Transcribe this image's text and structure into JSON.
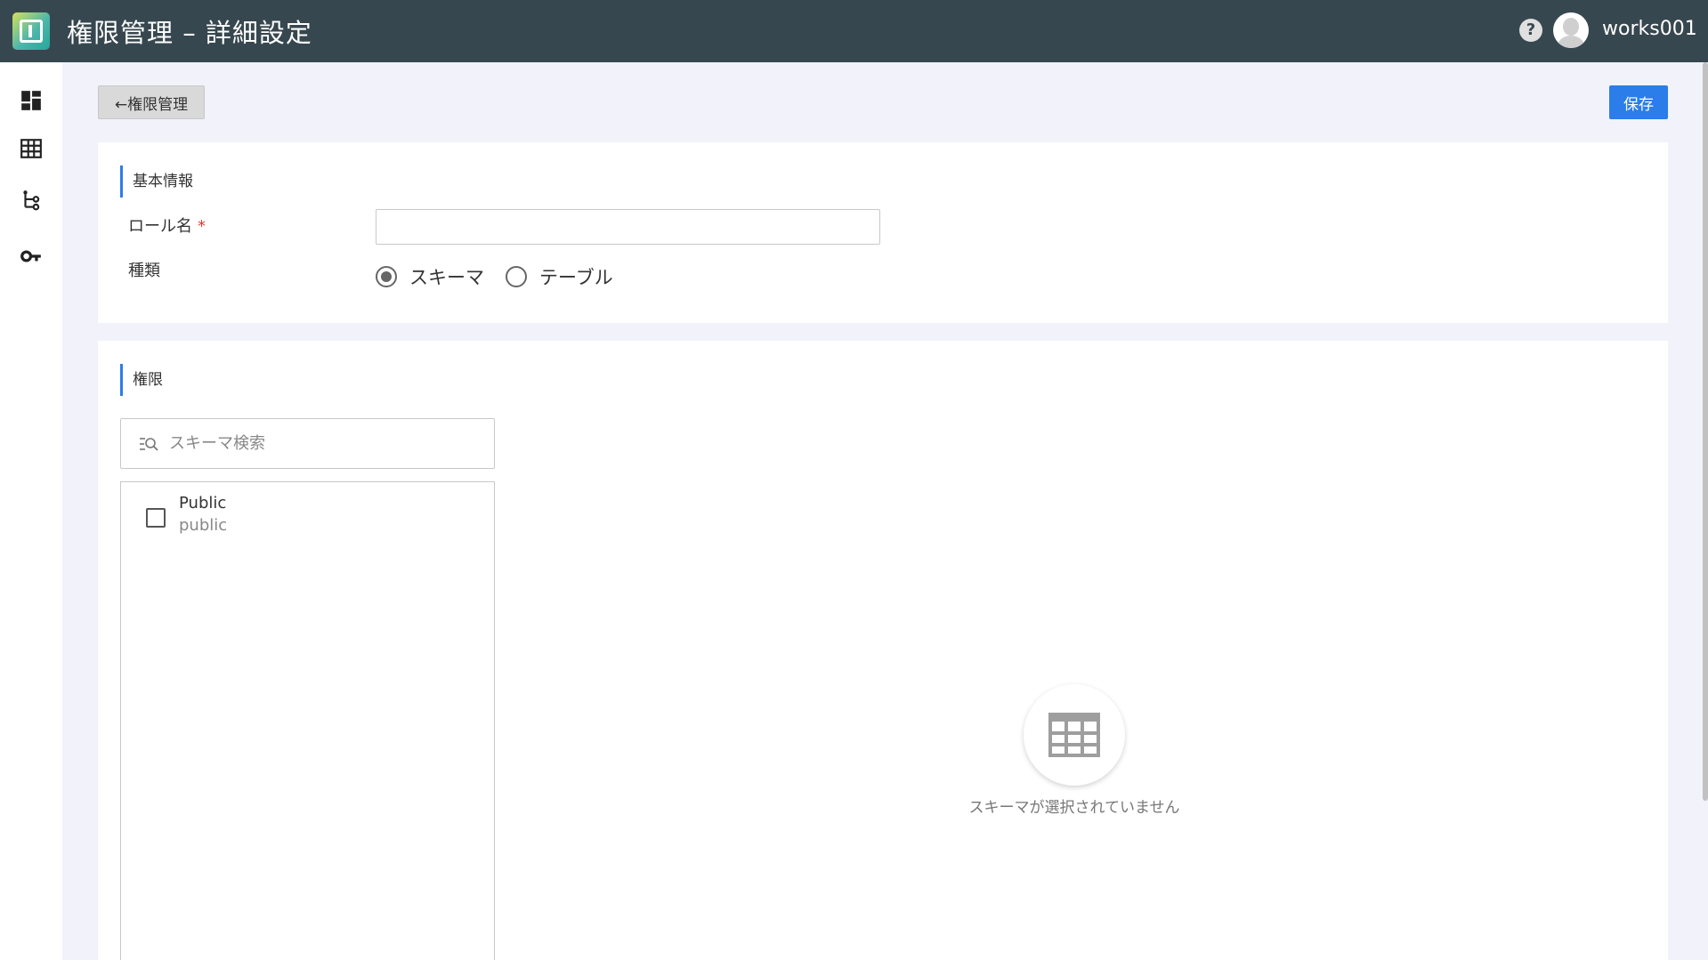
{
  "header": {
    "title": "権限管理 – 詳細設定",
    "help": "?",
    "username": "works001"
  },
  "sidebar": {
    "items": [
      {
        "icon": "dashboard-icon"
      },
      {
        "icon": "table-icon"
      },
      {
        "icon": "tree-icon"
      },
      {
        "icon": "key-icon"
      }
    ]
  },
  "toolbar": {
    "back_label": "←権限管理",
    "save_label": "保存"
  },
  "basic_info": {
    "section_title": "基本情報",
    "role_name_label": "ロール名",
    "required_mark": "*",
    "role_name_value": "",
    "type_label": "種類",
    "type_options": [
      "スキーマ",
      "テーブル"
    ],
    "type_selected": "スキーマ"
  },
  "permissions": {
    "section_title": "権限",
    "search_placeholder": "スキーマ検索",
    "schemas": [
      {
        "name": "Public",
        "sub": "public",
        "checked": false
      }
    ],
    "empty_message": "スキーマが選択されていません"
  },
  "colors": {
    "header_bg": "#37474f",
    "accent": "#2b7de9",
    "page_bg": "#f1f2fa"
  }
}
